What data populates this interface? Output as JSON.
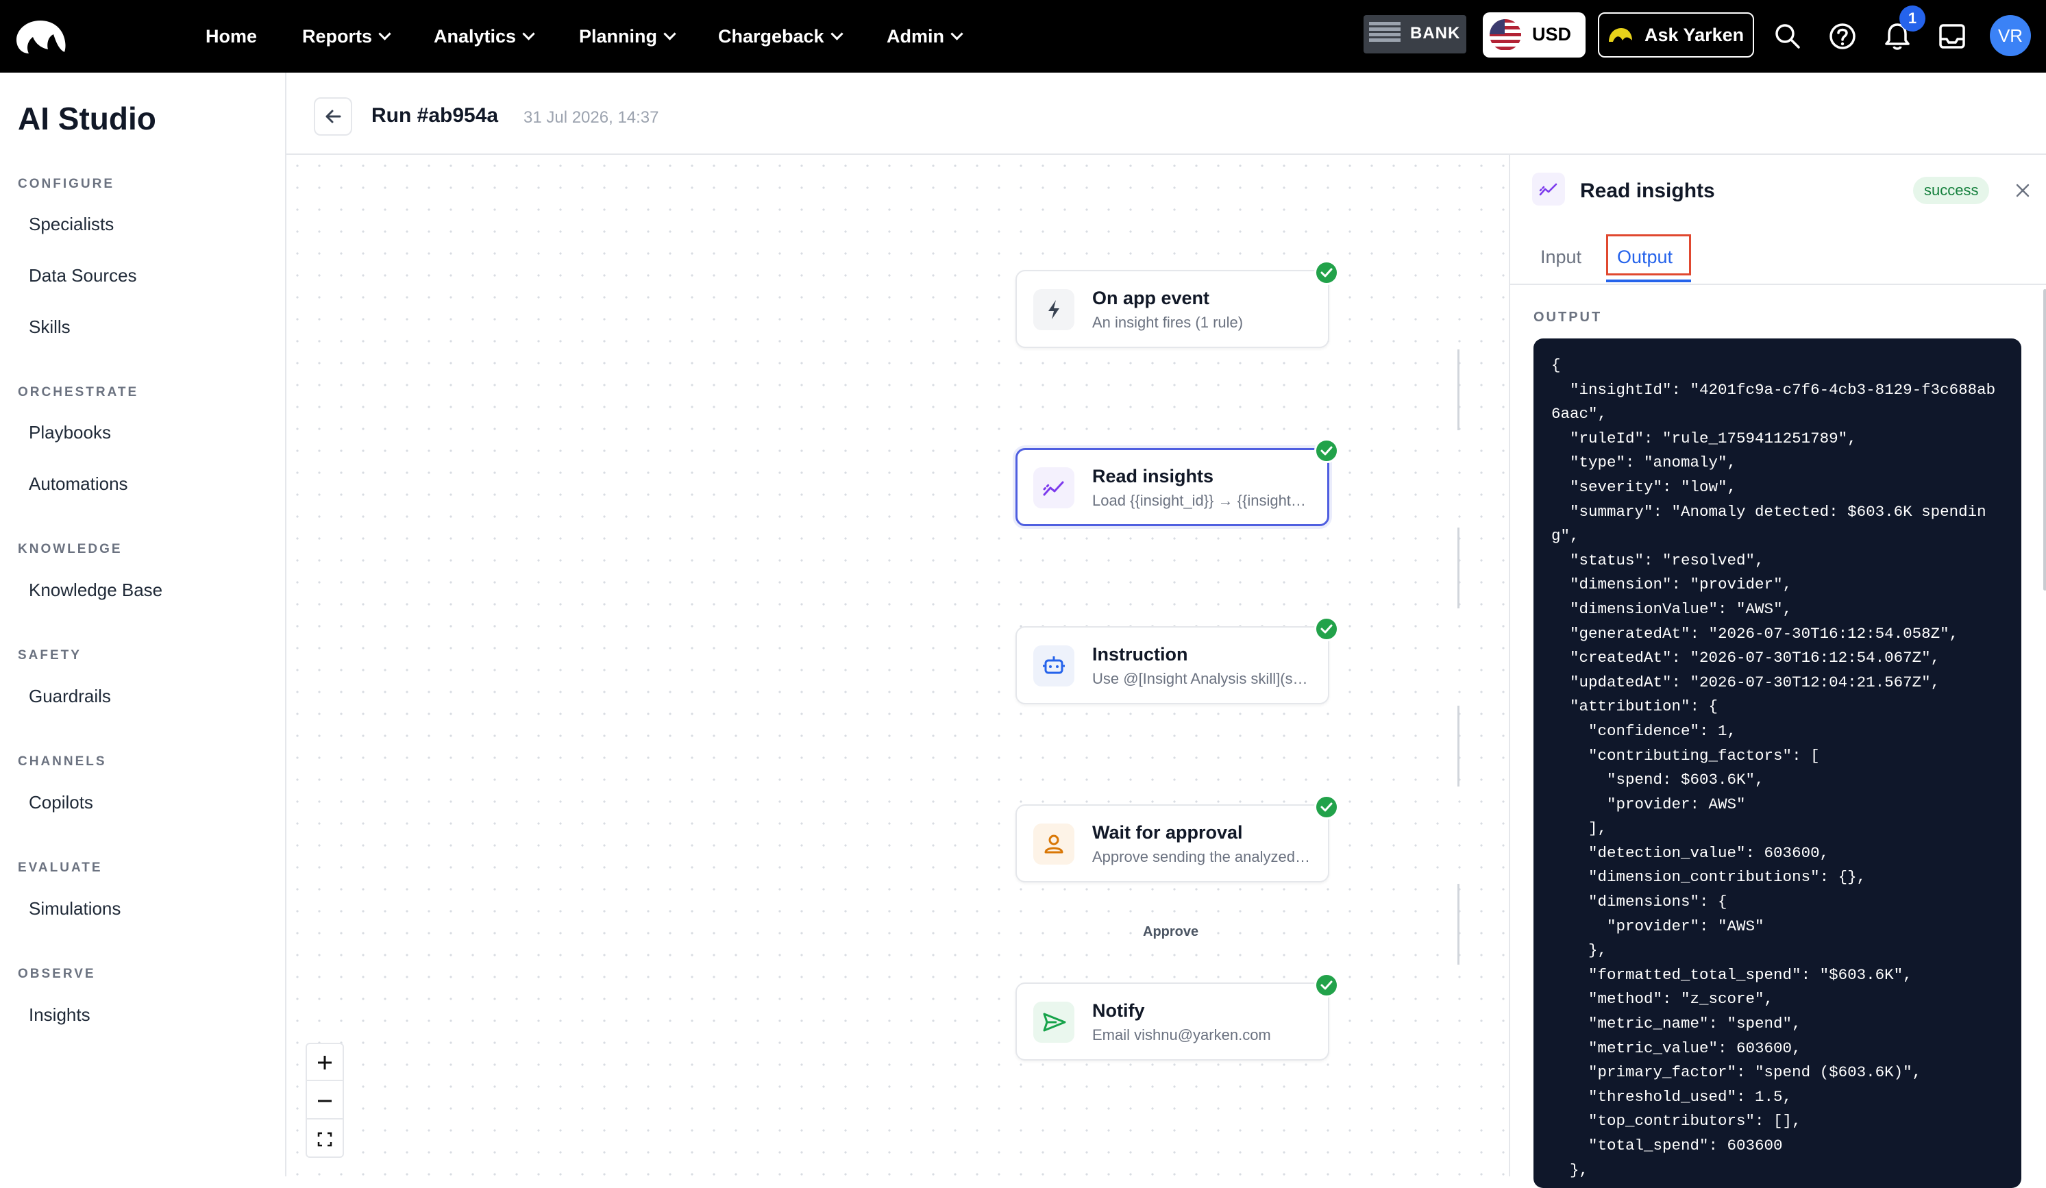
{
  "nav": {
    "items": [
      {
        "label": "Home",
        "dropdown": false
      },
      {
        "label": "Reports",
        "dropdown": true
      },
      {
        "label": "Analytics",
        "dropdown": true
      },
      {
        "label": "Planning",
        "dropdown": true
      },
      {
        "label": "Chargeback",
        "dropdown": true
      },
      {
        "label": "Admin",
        "dropdown": true
      }
    ],
    "bank_label": "BANK",
    "currency": "USD",
    "ask_label": "Ask Yarken",
    "notification_count": "1",
    "user_initials": "VR",
    "icons": [
      "logo-icon",
      "search-icon",
      "help-icon",
      "bell-icon",
      "inbox-icon"
    ]
  },
  "sidebar": {
    "title": "AI Studio",
    "sections": [
      {
        "label": "CONFIGURE",
        "items": [
          "Specialists",
          "Data Sources",
          "Skills"
        ]
      },
      {
        "label": "ORCHESTRATE",
        "items": [
          "Playbooks",
          "Automations"
        ]
      },
      {
        "label": "KNOWLEDGE",
        "items": [
          "Knowledge Base"
        ]
      },
      {
        "label": "SAFETY",
        "items": [
          "Guardrails"
        ]
      },
      {
        "label": "CHANNELS",
        "items": [
          "Copilots"
        ]
      },
      {
        "label": "EVALUATE",
        "items": [
          "Simulations"
        ]
      },
      {
        "label": "OBSERVE",
        "items": [
          "Insights"
        ]
      }
    ]
  },
  "header": {
    "title": "Run #ab954a",
    "timestamp": "31 Jul 2026, 14:37"
  },
  "flow": {
    "nodes": [
      {
        "title": "On app event",
        "subtitle": "An insight fires (1 rule)",
        "icon": "bolt-icon",
        "status": "success"
      },
      {
        "title": "Read insights",
        "subtitle": "Load {{insight_id}} → {{insight_data}}",
        "icon": "trend-icon",
        "status": "success",
        "selected": true
      },
      {
        "title": "Instruction",
        "subtitle": "Use @[Insight Analysis skill](skill) to analyze the insight",
        "icon": "robot-icon",
        "status": "success"
      },
      {
        "title": "Wait for approval",
        "subtitle": "Approve sending the analyzed insight",
        "icon": "user-icon",
        "status": "success"
      },
      {
        "title": "Notify",
        "subtitle": "Email vishnu@yarken.com",
        "icon": "send-icon",
        "status": "success"
      }
    ],
    "edge_label": "Approve"
  },
  "panel": {
    "title": "Read insights",
    "status": "success",
    "tabs": [
      {
        "label": "Input",
        "active": false
      },
      {
        "label": "Output",
        "active": true
      }
    ],
    "output_label": "OUTPUT",
    "output_json": "{\n  \"insightId\": \"4201fc9a-c7f6-4cb3-8129-f3c688ab6aac\",\n  \"ruleId\": \"rule_1759411251789\",\n  \"type\": \"anomaly\",\n  \"severity\": \"low\",\n  \"summary\": \"Anomaly detected: $603.6K spending\",\n  \"status\": \"resolved\",\n  \"dimension\": \"provider\",\n  \"dimensionValue\": \"AWS\",\n  \"generatedAt\": \"2026-07-30T16:12:54.058Z\",\n  \"createdAt\": \"2026-07-30T16:12:54.067Z\",\n  \"updatedAt\": \"2026-07-30T12:04:21.567Z\",\n  \"attribution\": {\n    \"confidence\": 1,\n    \"contributing_factors\": [\n      \"spend: $603.6K\",\n      \"provider: AWS\"\n    ],\n    \"detection_value\": 603600,\n    \"dimension_contributions\": {},\n    \"dimensions\": {\n      \"provider\": \"AWS\"\n    },\n    \"formatted_total_spend\": \"$603.6K\",\n    \"method\": \"z_score\",\n    \"metric_name\": \"spend\",\n    \"metric_value\": 603600,\n    \"primary_factor\": \"spend ($603.6K)\",\n    \"threshold_used\": 1.5,\n    \"top_contributors\": [],\n    \"total_spend\": 603600\n  },"
  },
  "colors": {
    "accent": "#2563eb",
    "success": "#22a24a",
    "selected_border": "#4f5fe0",
    "code_bg": "#0f172a",
    "highlight": "#e0482f"
  }
}
